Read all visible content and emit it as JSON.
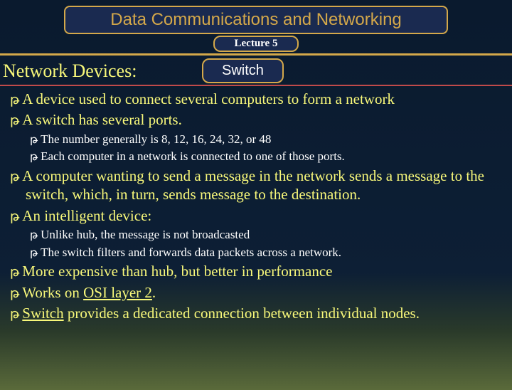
{
  "title": "Data Communications and Networking",
  "lecture": "Lecture 5",
  "section": "Network Devices:",
  "topic": "Switch",
  "bullets": {
    "b1": "A device used to connect several computers to form a network",
    "b2": "A switch has several ports.",
    "b2a": "The number generally is 8, 12, 16, 24, 32, or 48",
    "b2b": "Each computer in a network is connected to one of those ports.",
    "b3": "A computer wanting to send a message in the network sends a message to the switch, which, in turn, sends message to the destination.",
    "b4": "An intelligent device:",
    "b4a": "Unlike hub, the message is not broadcasted",
    "b4b": "The switch filters and forwards data packets across a network.",
    "b5": "More expensive than hub, but better in performance",
    "b6_pre": "Works on ",
    "b6_link": "OSI layer 2",
    "b6_post": ".",
    "b7_link": "Switch",
    "b7_post": " provides a dedicated connection between individual nodes."
  },
  "bullet_glyph": "թ"
}
